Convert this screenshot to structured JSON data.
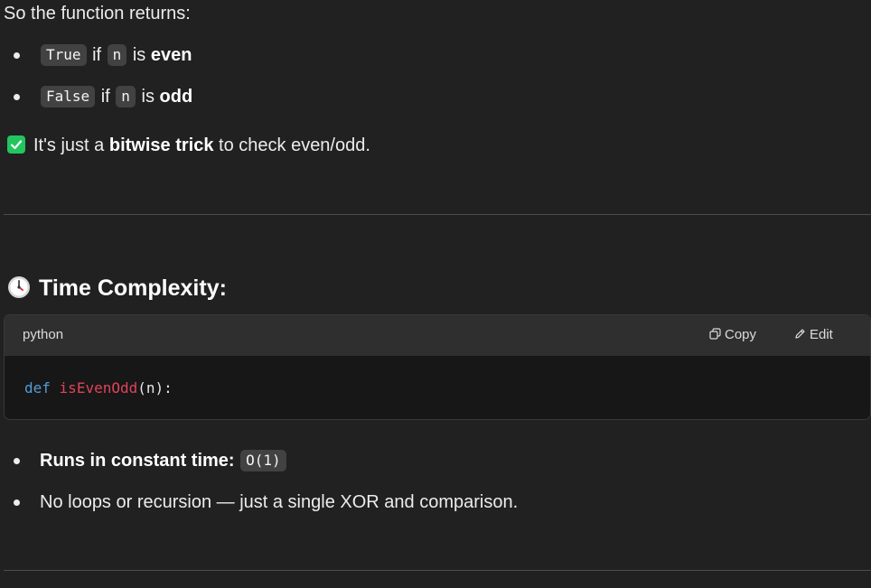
{
  "intro": {
    "text": "So the function returns:"
  },
  "returns_list": [
    {
      "value": "True",
      "if_word": "if",
      "var": "n",
      "is_word": "is",
      "parity": "even"
    },
    {
      "value": "False",
      "if_word": "if",
      "var": "n",
      "is_word": "is",
      "parity": "odd"
    }
  ],
  "check_note": {
    "icon": "check-mark-icon",
    "pre": "It's just a ",
    "bold": "bitwise trick",
    "post": " to check even/odd."
  },
  "section": {
    "icon": "clock-icon",
    "title": "Time Complexity:"
  },
  "code_block": {
    "language": "python",
    "copy_label": "Copy",
    "edit_label": "Edit",
    "code": {
      "keyword": "def",
      "function": "isEvenOdd",
      "rest": "(n):"
    }
  },
  "complexity_list": [
    {
      "bold": "Runs in constant time:",
      "code": "O(1)"
    },
    {
      "text": "No loops or recursion — just a single XOR and comparison."
    }
  ],
  "colors": {
    "background": "#212121",
    "check_green": "#22c55e",
    "keyword_blue": "#569cd6",
    "function_red": "#e0435a"
  }
}
